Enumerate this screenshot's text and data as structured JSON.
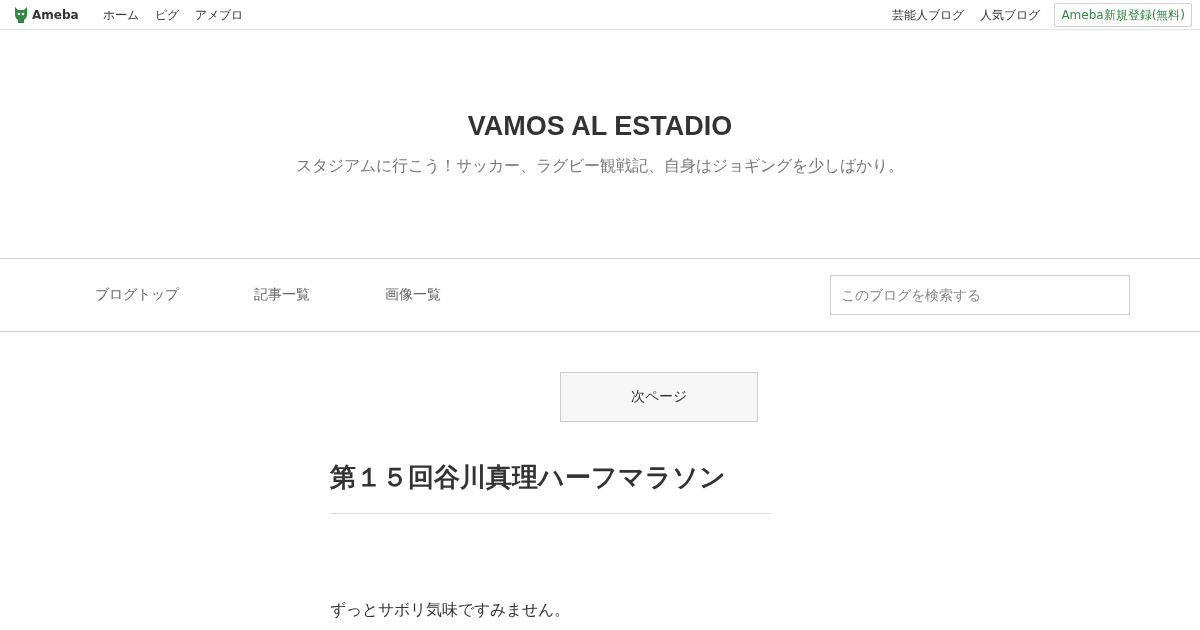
{
  "topbar": {
    "logo": "Ameba",
    "links": [
      "ホーム",
      "ピグ",
      "アメブロ"
    ],
    "right_links": [
      "芸能人ブログ",
      "人気ブログ"
    ],
    "signup": "Ameba新規登録(無料)"
  },
  "blog": {
    "title": "VAMOS AL ESTADIO",
    "description": "スタジアムに行こう！サッカー、ラグビー観戦記、自身はジョギングを少しばかり。"
  },
  "nav": {
    "items": [
      "ブログトップ",
      "記事一覧",
      "画像一覧"
    ],
    "search": {
      "placeholder": "このブログを検索する"
    }
  },
  "article": {
    "next_page": "次ページ",
    "title": "第１５回谷川真理ハーフマラソン",
    "body": "ずっとサボリ気味ですみません。"
  }
}
